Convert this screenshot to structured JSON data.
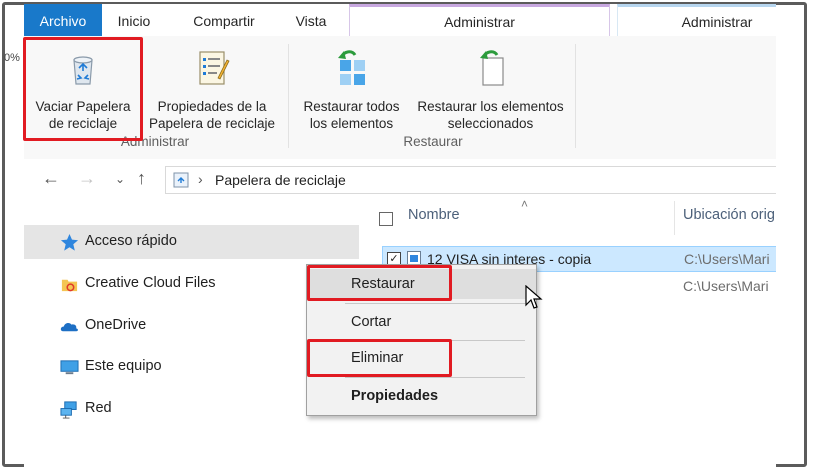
{
  "tabs": {
    "file": "Archivo",
    "home": "Inicio",
    "share": "Compartir",
    "view": "Vista",
    "manage1": "Administrar",
    "manage2": "Administrar"
  },
  "ribbon": {
    "empty_bin": [
      "Vaciar Papelera",
      "de reciclaje"
    ],
    "bin_props": [
      "Propiedades de la",
      "Papelera de reciclaje"
    ],
    "restore_all": [
      "Restaurar todos",
      "los elementos"
    ],
    "restore_selected": [
      "Restaurar los elementos",
      "seleccionados"
    ],
    "group_manage": "Administrar",
    "group_restore": "Restaurar",
    "left_cut": "0%"
  },
  "address": {
    "path": "Papelera de reciclaje"
  },
  "nav": {
    "items": [
      {
        "label": "Acceso rápido",
        "icon": "star-icon"
      },
      {
        "label": "Creative Cloud Files",
        "icon": "creative-cloud-icon"
      },
      {
        "label": "OneDrive",
        "icon": "onedrive-icon"
      },
      {
        "label": "Este equipo",
        "icon": "computer-icon"
      },
      {
        "label": "Red",
        "icon": "network-icon"
      }
    ]
  },
  "list": {
    "col_name": "Nombre",
    "col_location": "Ubicación orig",
    "rows": [
      {
        "name": "12 VISA sin interes - copia",
        "location": "C:\\Users\\Mari"
      },
      {
        "name": "",
        "location": "C:\\Users\\Mari"
      }
    ]
  },
  "context_menu": {
    "restore": "Restaurar",
    "cut": "Cortar",
    "delete": "Eliminar",
    "properties": "Propiedades"
  },
  "colors": {
    "accent": "#1979ca",
    "highlight": "#e11b22",
    "selection": "#cce8ff"
  }
}
